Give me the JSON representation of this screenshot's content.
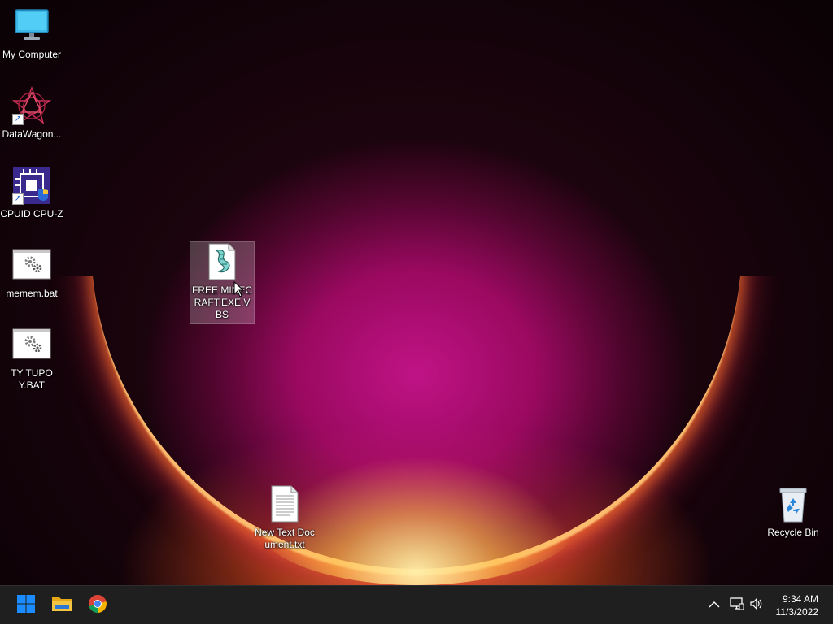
{
  "desktop_icons": [
    {
      "label": "My Computer",
      "icon": "computer-icon",
      "shortcut": false
    },
    {
      "label": "DataWagon...",
      "icon": "datawagon-icon",
      "shortcut": true
    },
    {
      "label": "CPUID CPU-Z",
      "icon": "cpuz-icon",
      "shortcut": true
    },
    {
      "label": "memem.bat",
      "icon": "batch-file-icon",
      "shortcut": false
    },
    {
      "label": "TY TUPOY.BAT",
      "icon": "batch-file-icon",
      "shortcut": false
    },
    {
      "label": "FREE MINECRAFT.EXE.VBS",
      "icon": "vbs-script-icon",
      "shortcut": false,
      "selected": true
    },
    {
      "label": "New Text Document.txt",
      "icon": "text-file-icon",
      "shortcut": false
    },
    {
      "label": "Recycle Bin",
      "icon": "recycle-bin-icon",
      "shortcut": false
    }
  ],
  "taskbar": {
    "pinned": [
      {
        "name": "Start",
        "icon": "windows-start-icon"
      },
      {
        "name": "File Explorer",
        "icon": "folder-icon"
      },
      {
        "name": "Google Chrome",
        "icon": "chrome-icon"
      }
    ],
    "tray": {
      "time": "9:34 AM",
      "date": "11/3/2022"
    }
  },
  "colors": {
    "taskbar_bg": "#1f1f1f",
    "start_blue": "#1a8cff",
    "folder_yellow": "#f4c542"
  }
}
